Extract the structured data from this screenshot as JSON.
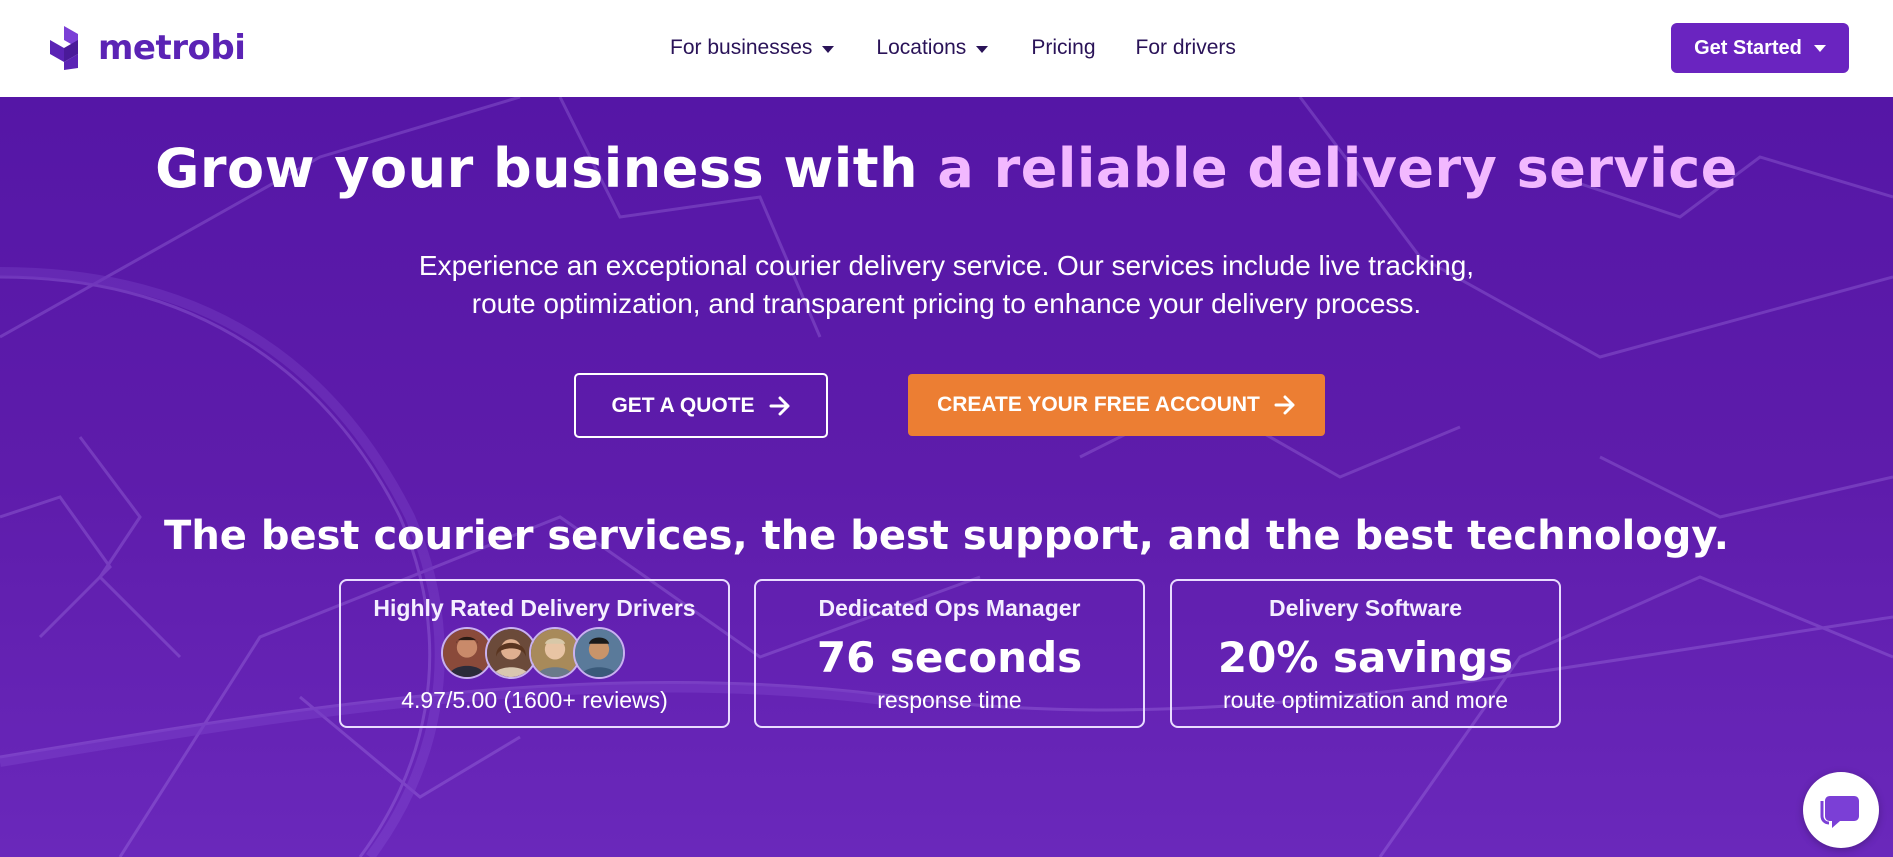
{
  "header": {
    "logo_text": "metrobi",
    "nav": [
      {
        "label": "For businesses",
        "has_dropdown": true
      },
      {
        "label": "Locations",
        "has_dropdown": true
      },
      {
        "label": "Pricing",
        "has_dropdown": false
      },
      {
        "label": "For drivers",
        "has_dropdown": false
      }
    ],
    "cta_label": "Get Started"
  },
  "hero": {
    "title_plain": "Grow your business with ",
    "title_accent": "a reliable delivery service",
    "subtitle_line1": "Experience an exceptional courier delivery service. Our services include live tracking,",
    "subtitle_line2": "route optimization, and transparent pricing to enhance your delivery process.",
    "quote_button": "GET A QUOTE",
    "account_button": "CREATE YOUR FREE ACCOUNT",
    "tagline": "The best courier services, the best support, and the best technology."
  },
  "cards": [
    {
      "title": "Highly Rated Delivery Drivers",
      "rating": "4.97/5.00 (1600+ reviews)"
    },
    {
      "title": "Dedicated Ops Manager",
      "big": "76 seconds",
      "sub": "response time"
    },
    {
      "title": "Delivery Software",
      "big": "20% savings",
      "sub": "route optimization and more"
    }
  ],
  "colors": {
    "brand_purple": "#6a24c0",
    "hero_bg": "#5a1ea8",
    "accent_pink": "#f2b8ff",
    "cta_orange": "#ec7e33"
  },
  "icons": {
    "chevron": "caret-down-icon",
    "arrow": "arrow-right-icon",
    "chat": "chat-bubble-icon"
  }
}
